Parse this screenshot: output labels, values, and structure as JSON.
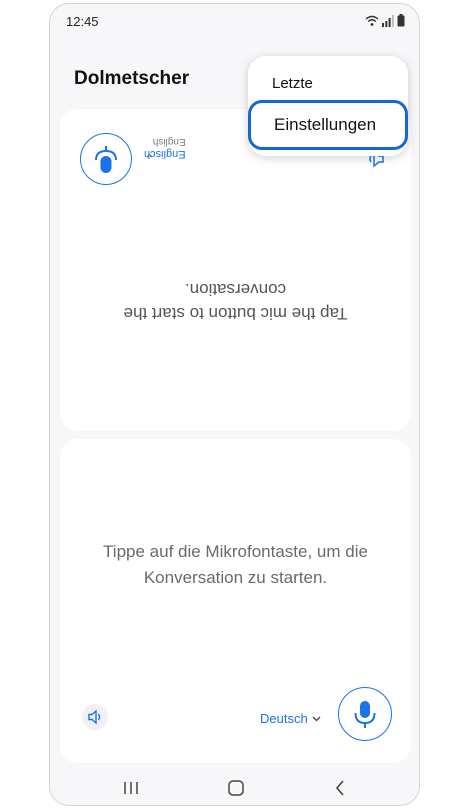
{
  "status_bar": {
    "time": "12:45"
  },
  "app_bar": {
    "title": "Dolmetscher"
  },
  "top_panel": {
    "language_label": "Englisch",
    "language_sublabel": "English",
    "message": "Tap the mic button to start the conversation."
  },
  "bottom_panel": {
    "message": "Tippe auf die Mikrofontaste, um die Konversation zu starten.",
    "language_label": "Deutsch"
  },
  "overflow_menu": {
    "items": [
      {
        "label": "Letzte"
      },
      {
        "label": "Einstellungen",
        "highlighted": true
      }
    ]
  },
  "colors": {
    "accent": "#1a73e8",
    "highlight_border": "#1a64d8"
  }
}
